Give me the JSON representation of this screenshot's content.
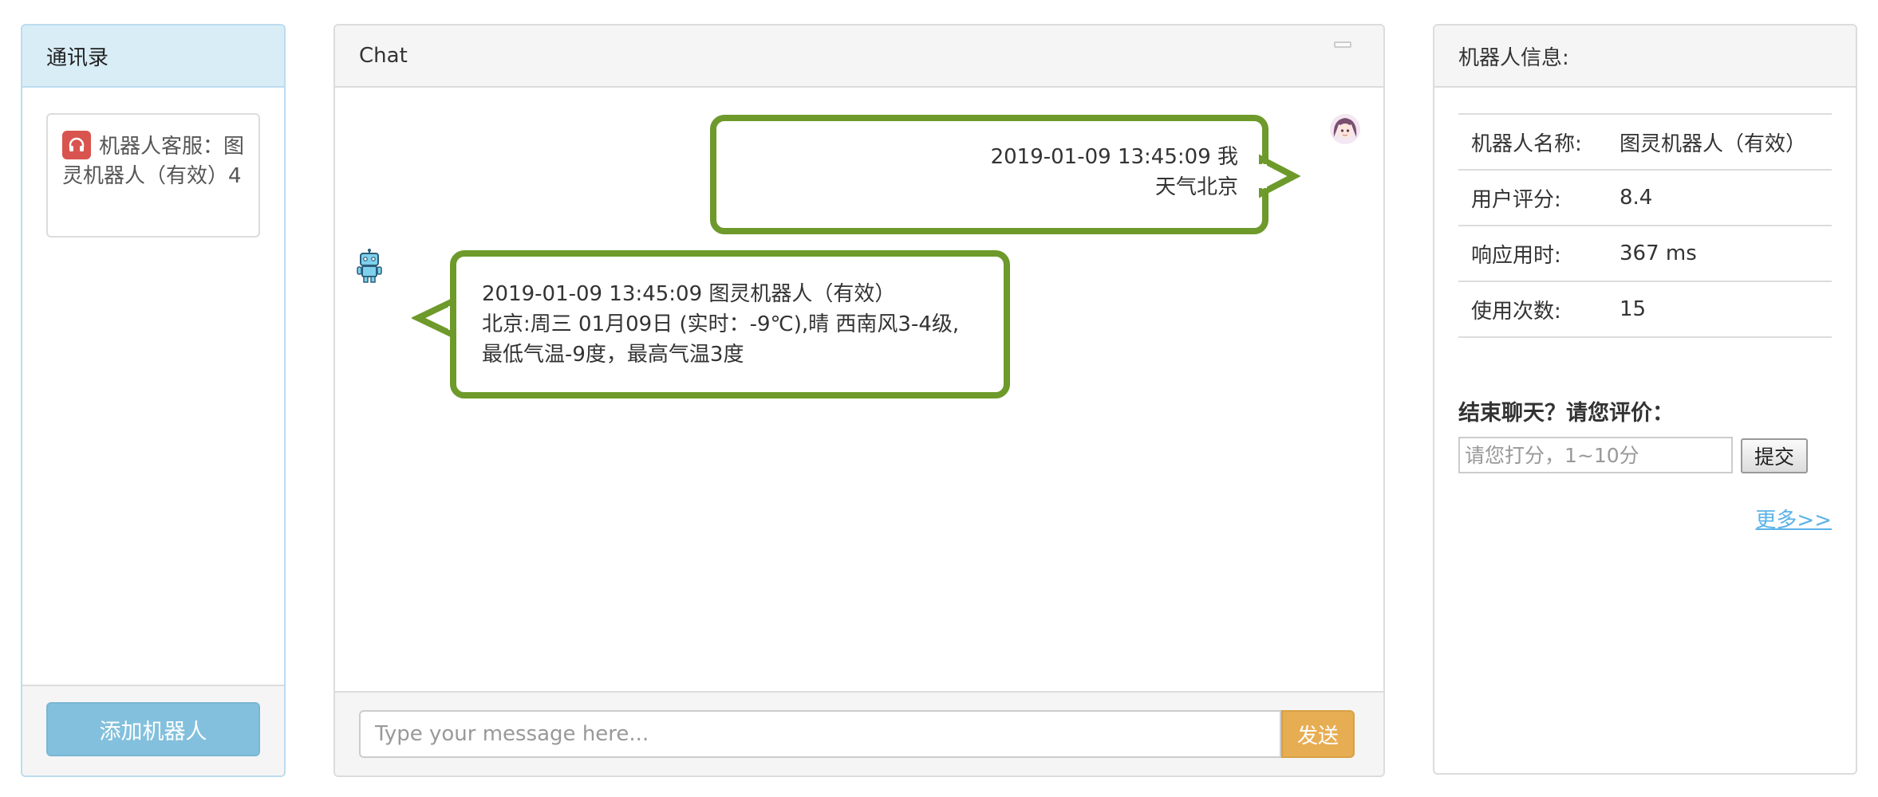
{
  "contacts": {
    "title": "通讯录",
    "items": [
      {
        "name": "机器人客服：图灵机器人（有效）4"
      }
    ],
    "add_button": "添加机器人"
  },
  "chat": {
    "title": "Chat",
    "messages": [
      {
        "sender": "me",
        "line1": "2019-01-09 13:45:09 我",
        "line2": "天气北京"
      },
      {
        "sender": "bot",
        "line1": "2019-01-09 13:45:09 图灵机器人（有效）",
        "line2": "北京:周三 01月09日 (实时：-9℃),晴 西南风3-4级,",
        "line3": "最低气温-9度，最高气温3度"
      }
    ],
    "input_placeholder": "Type your message here...",
    "send_button": "发送"
  },
  "info": {
    "title": "机器人信息:",
    "rows": [
      {
        "label": "机器人名称:",
        "value": "图灵机器人（有效）"
      },
      {
        "label": "用户评分:",
        "value": "8.4"
      },
      {
        "label": "响应用时:",
        "value": "367 ms"
      },
      {
        "label": "使用次数:",
        "value": "15"
      }
    ],
    "rate_title": "结束聊天？请您评价：",
    "rate_placeholder": "请您打分，1~10分",
    "submit_button": "提交",
    "more_link": "更多>>"
  },
  "colors": {
    "bubble_border": "#6d9a2a",
    "send_button": "#e7ad53",
    "add_button": "#83c0dd",
    "link": "#5bb2e8",
    "headset_badge": "#d9534f"
  }
}
